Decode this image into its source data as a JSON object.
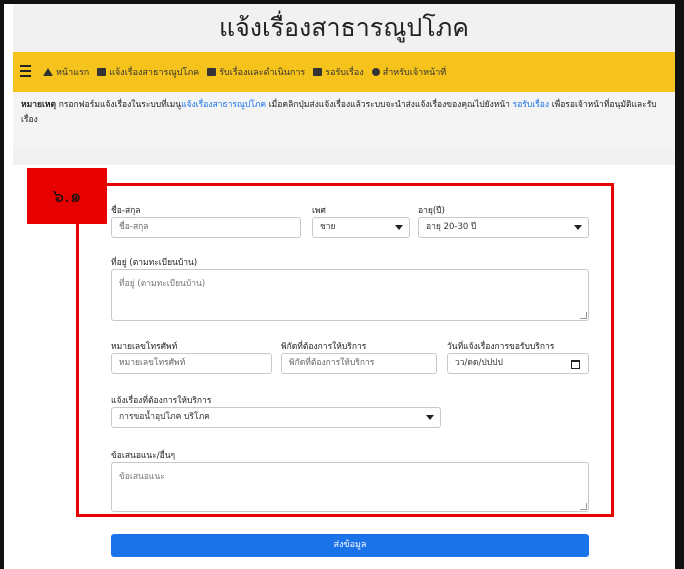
{
  "page_title": "แจ้งเรื่องสาธารณูปโภค",
  "nav": {
    "items": [
      {
        "label": "หน้าแรก",
        "icon": "home-icon"
      },
      {
        "label": "แจ้งเรื่องสาธารณูปโภค",
        "icon": "calendar-icon"
      },
      {
        "label": "รับเรื่องและดำเนินการ",
        "icon": "inbox-icon"
      },
      {
        "label": "รอรับเรื่อง",
        "icon": "inbox-icon"
      },
      {
        "label": "สำหรับเจ้าหน้าที่",
        "icon": "users-icon"
      }
    ]
  },
  "notice": {
    "bold": "หมายเหตุ",
    "part1": "กรอกฟอร์มแจ้งเรื่องในระบบที่เมนู",
    "link1": "แจ้งเรื่องสาธารณูปโภค",
    "part2": "เมื่อคลิกปุ่มส่งแจ้งเรื่องแล้วระบบจะนำส่งแจ้งเรื่องของคุณไปยังหน้า",
    "link2": "รอรับเรื่อง",
    "part3": "เพื่อรอเจ้าหน้าที่อนุมัติและรับเรื่อง"
  },
  "annotation": {
    "tag": "๖.๑"
  },
  "form": {
    "name": {
      "label": "ชื่อ-สกุล",
      "placeholder": "ชื่อ-สกุล"
    },
    "gender": {
      "label": "เพศ",
      "value": "ชาย"
    },
    "age": {
      "label": "อายุ(ปี)",
      "value": "อายุ 20-30 ปี"
    },
    "address": {
      "label": "ที่อยู่ (ตามทะเบียนบ้าน)",
      "placeholder": "ที่อยู่ (ตามทะเบียนบ้าน)"
    },
    "phone": {
      "label": "หมายเลขโทรศัพท์",
      "placeholder": "หมายเลขโทรศัพท์"
    },
    "location": {
      "label": "พิกัดที่ต้องการให้บริการ",
      "placeholder": "พิกัดที่ต้องการให้บริการ"
    },
    "date": {
      "label": "วันที่แจ้งเรื่องการขอรับบริการ",
      "placeholder": "วว/ดด/ปปปป"
    },
    "service": {
      "label": "แจ้งเรื่องที่ต้องการให้บริการ",
      "value": "การขอน้ำอุปโภค บริโภค"
    },
    "suggestion": {
      "label": "ข้อเสนอแนะ/อื่นๆ",
      "placeholder": "ข้อเสนอแนะ"
    }
  },
  "submit_label": "ส่งข้อมูล",
  "colors": {
    "navbar": "#f6c21c",
    "link": "#1a73e8",
    "annotation": "#e60000",
    "button": "#1a73e8"
  }
}
